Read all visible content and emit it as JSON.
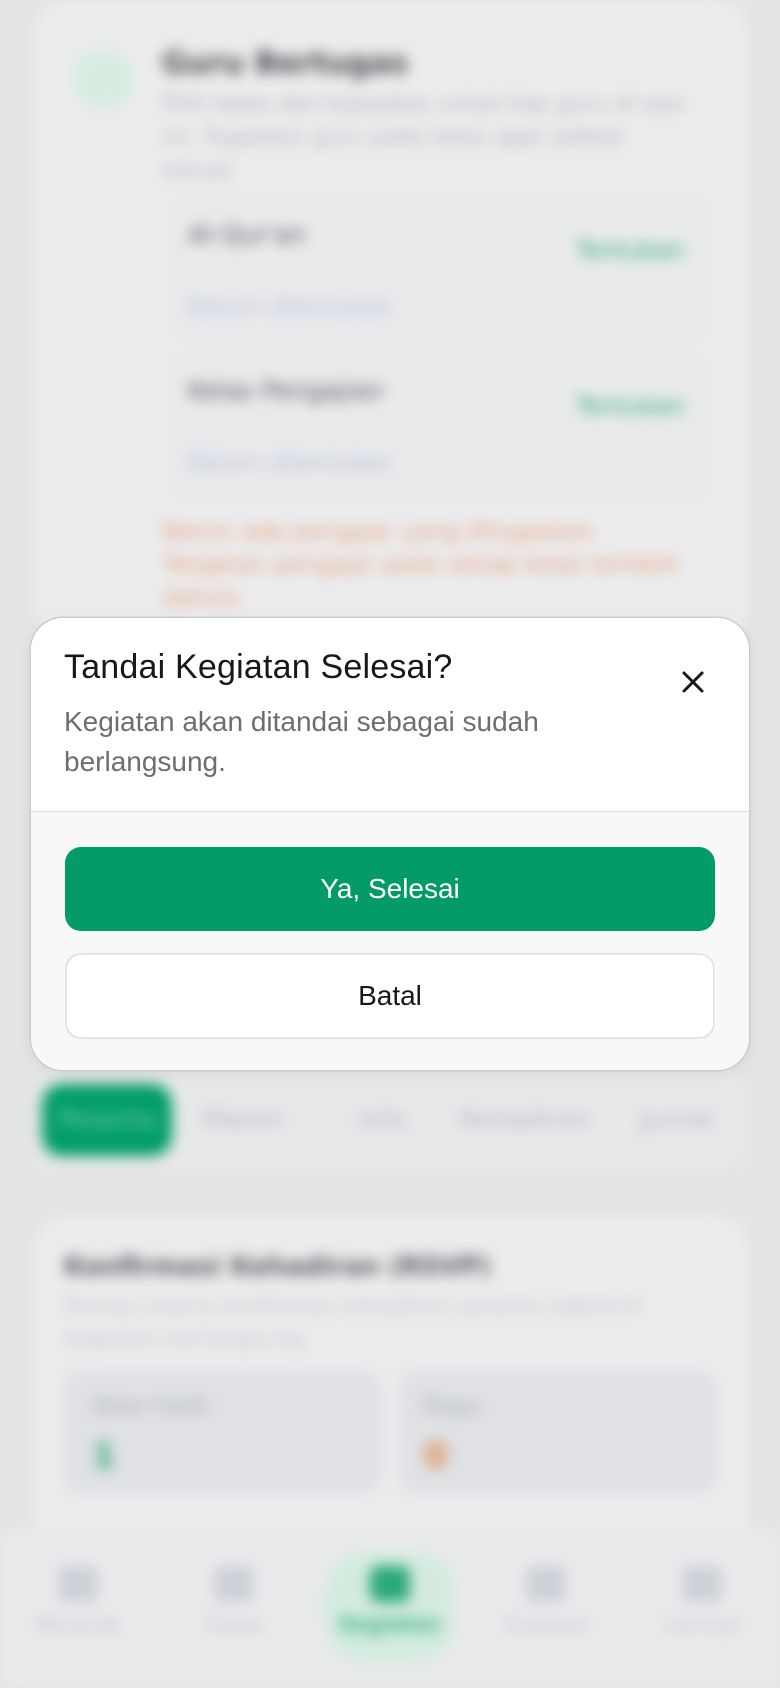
{
  "modal": {
    "title": "Tandai Kegiatan Selesai?",
    "description": "Kegiatan akan ditandai sebagai sudah berlangsung.",
    "close_icon": "close-icon",
    "confirm_label": "Ya, Selesai",
    "cancel_label": "Batal"
  },
  "background": {
    "section_title": "Guru Bertugas",
    "section_desc": "Pilih kelas dan kapasitas untuk tiap guru di sesi ini. Tugaskan guru pada kelas agar jadwal sesuai.",
    "assignments": [
      {
        "name": "Al-Qur'an",
        "value": "Belum ditentukan",
        "action": "Tentukan"
      },
      {
        "name": "Kelas Pengajian",
        "value": "Belum ditentukan",
        "action": "Tentukan"
      }
    ],
    "warning": "Belum ada pengajar yang ditugaskan. Tetapkan pengajar pada setiap kelas terlebih dahulu.",
    "tabs": [
      "Peserta",
      "Materi",
      "Info",
      "Kehadiran",
      "Jurnal"
    ],
    "active_tab": "Peserta",
    "rsvp_title": "Konfirmasi Kehadiran (RSVP)",
    "rsvp_desc": "Pantau status konfirmasi kehadiran peserta sebelum kegiatan berlangsung.",
    "stats": [
      {
        "label": "Akan hadir",
        "value": "1"
      },
      {
        "label": "Ragu",
        "value": "0"
      }
    ],
    "nav": [
      "Beranda",
      "Siswa",
      "Kegiatan",
      "Evaluasi",
      "Lainnya"
    ],
    "active_nav": "Kegiatan"
  },
  "colors": {
    "primary": "#029a66",
    "warning": "#e08a4e",
    "overlay": "#e3e4e6"
  }
}
